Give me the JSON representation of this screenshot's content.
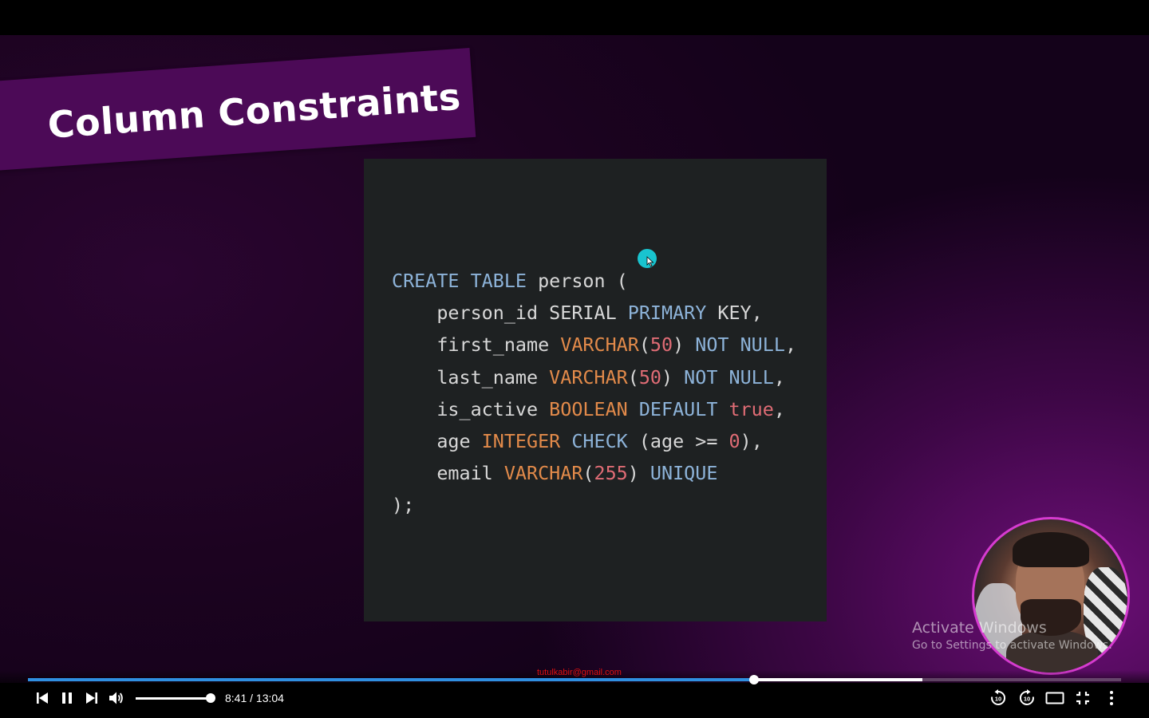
{
  "slide": {
    "title": "Column Constraints",
    "code_lines": [
      [
        {
          "t": "CREATE",
          "c": "kw"
        },
        {
          "t": " ",
          "c": "plain"
        },
        {
          "t": "TABLE",
          "c": "kw"
        },
        {
          "t": " person (",
          "c": "plain"
        }
      ],
      [
        {
          "t": "    person_id SERIAL ",
          "c": "plain"
        },
        {
          "t": "PRIMARY",
          "c": "kw"
        },
        {
          "t": " KEY,",
          "c": "plain"
        }
      ],
      [
        {
          "t": "    first_name ",
          "c": "plain"
        },
        {
          "t": "VARCHAR",
          "c": "ty"
        },
        {
          "t": "(",
          "c": "plain"
        },
        {
          "t": "50",
          "c": "num"
        },
        {
          "t": ") ",
          "c": "plain"
        },
        {
          "t": "NOT NULL",
          "c": "kw"
        },
        {
          "t": ",",
          "c": "plain"
        }
      ],
      [
        {
          "t": "    last_name ",
          "c": "plain"
        },
        {
          "t": "VARCHAR",
          "c": "ty"
        },
        {
          "t": "(",
          "c": "plain"
        },
        {
          "t": "50",
          "c": "num"
        },
        {
          "t": ") ",
          "c": "plain"
        },
        {
          "t": "NOT NULL",
          "c": "kw"
        },
        {
          "t": ",",
          "c": "plain"
        }
      ],
      [
        {
          "t": "    is_active ",
          "c": "plain"
        },
        {
          "t": "BOOLEAN",
          "c": "ty"
        },
        {
          "t": " ",
          "c": "plain"
        },
        {
          "t": "DEFAULT",
          "c": "kw"
        },
        {
          "t": " ",
          "c": "plain"
        },
        {
          "t": "true",
          "c": "bool"
        },
        {
          "t": ",",
          "c": "plain"
        }
      ],
      [
        {
          "t": "    age ",
          "c": "plain"
        },
        {
          "t": "INTEGER",
          "c": "ty"
        },
        {
          "t": " ",
          "c": "plain"
        },
        {
          "t": "CHECK",
          "c": "kw"
        },
        {
          "t": " (age >= ",
          "c": "plain"
        },
        {
          "t": "0",
          "c": "num"
        },
        {
          "t": "),",
          "c": "plain"
        }
      ],
      [
        {
          "t": "    email ",
          "c": "plain"
        },
        {
          "t": "VARCHAR",
          "c": "ty"
        },
        {
          "t": "(",
          "c": "plain"
        },
        {
          "t": "255",
          "c": "num"
        },
        {
          "t": ") ",
          "c": "plain"
        },
        {
          "t": "UNIQUE",
          "c": "kw"
        }
      ],
      [
        {
          "t": ");",
          "c": "plain"
        }
      ]
    ]
  },
  "watermark": {
    "title": "Activate Windows",
    "subtitle": "Go to Settings to activate Windows."
  },
  "overlay_email": "tutulkabir@gmail.com",
  "player": {
    "current_time": "8:41",
    "duration": "13:04",
    "time_label": "8:41 / 13:04",
    "played_fraction": 0.664,
    "buffered_fraction": 0.818,
    "volume_fraction": 1.0,
    "state": "playing"
  },
  "icons": {
    "previous": "skip-previous-icon",
    "pause": "pause-icon",
    "next": "skip-next-icon",
    "volume": "volume-icon",
    "rewind": "rewind-10-icon",
    "forward": "forward-10-icon",
    "theater": "theater-mode-icon",
    "exit_fullscreen": "exit-fullscreen-icon",
    "more": "more-options-icon"
  },
  "colors": {
    "progress_played": "#2f8fe0",
    "banner": "#4c0a57",
    "cursor_highlight": "#19c4cf",
    "webcam_ring": "#d63bd0"
  }
}
